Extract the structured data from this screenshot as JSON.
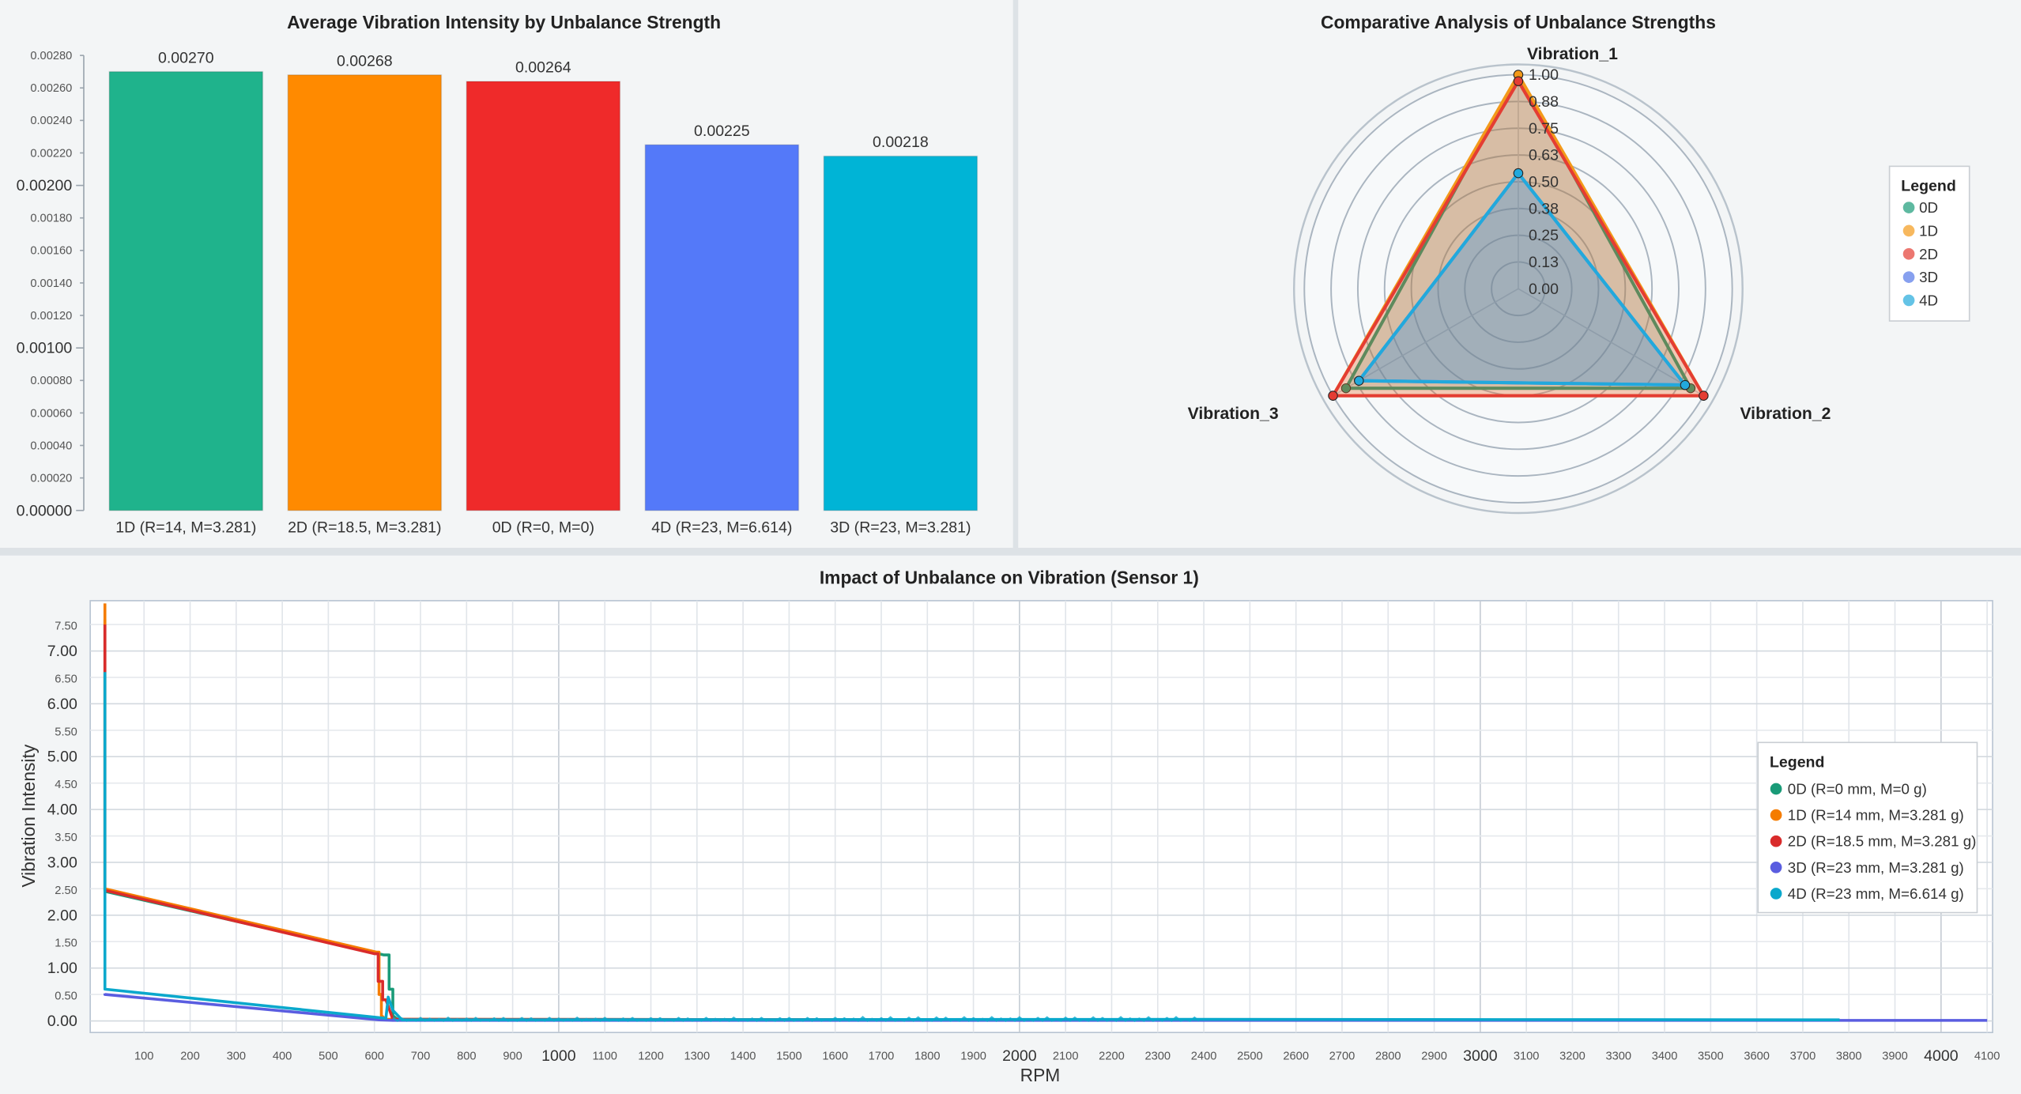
{
  "chart_data": [
    {
      "type": "bar",
      "title": "Average Vibration Intensity by Unbalance Strength",
      "categories": [
        "1D (R=14, M=3.281)",
        "2D (R=18.5, M=3.281)",
        "0D (R=0, M=0)",
        "4D (R=23, M=6.614)",
        "3D (R=23, M=3.281)"
      ],
      "values": [
        0.0027,
        0.00268,
        0.00264,
        0.00225,
        0.00218
      ],
      "value_labels": [
        "0.00270",
        "0.00268",
        "0.00264",
        "0.00225",
        "0.00218"
      ],
      "colors": [
        "#1fb38c",
        "#ff8a00",
        "#ef2a2a",
        "#5479f9",
        "#00b4d6"
      ],
      "ylim": [
        0,
        0.0028
      ],
      "yticks": [
        "0.00000",
        "0.00020",
        "0.00040",
        "0.00060",
        "0.00080",
        "0.00100",
        "0.00120",
        "0.00140",
        "0.00160",
        "0.00180",
        "0.00200",
        "0.00220",
        "0.00240",
        "0.00260",
        "0.00280"
      ],
      "xlabel": "",
      "ylabel": ""
    },
    {
      "type": "radar",
      "title": "Comparative Analysis of Unbalance Strengths",
      "axes": [
        "Vibration_1",
        "Vibration_2",
        "Vibration_3"
      ],
      "rticks": [
        "0.00",
        "0.13",
        "0.25",
        "0.38",
        "0.50",
        "0.63",
        "0.75",
        "0.88",
        "1.00"
      ],
      "rlim": [
        0,
        1
      ],
      "legend_title": "Legend",
      "legend_position": "right",
      "series": [
        {
          "name": "0D",
          "color": "#1a9b78",
          "values": [
            1.0,
            0.93,
            0.93
          ]
        },
        {
          "name": "1D",
          "color": "#f39a1a",
          "values": [
            1.0,
            1.0,
            1.0
          ]
        },
        {
          "name": "2D",
          "color": "#e43d33",
          "values": [
            0.97,
            1.0,
            1.0
          ]
        },
        {
          "name": "3D",
          "color": "#5478e8",
          "values": [
            0.54,
            0.9,
            0.86
          ]
        },
        {
          "name": "4D",
          "color": "#22a9dc",
          "values": [
            0.54,
            0.9,
            0.86
          ]
        }
      ]
    },
    {
      "type": "line",
      "title": "Impact of Unbalance on Vibration (Sensor 1)",
      "xlabel": "RPM",
      "ylabel": "Vibration Intensity",
      "xlim": [
        0,
        4100
      ],
      "ylim": [
        0,
        8.0
      ],
      "xticks": [
        100,
        200,
        300,
        400,
        500,
        600,
        700,
        800,
        900,
        1000,
        1100,
        1200,
        1300,
        1400,
        1500,
        1600,
        1700,
        1800,
        1900,
        2000,
        2100,
        2200,
        2300,
        2400,
        2500,
        2600,
        2700,
        2800,
        2900,
        3000,
        3100,
        3200,
        3300,
        3400,
        3500,
        3600,
        3700,
        3800,
        3900,
        4000,
        4100
      ],
      "yticks": [
        "0.00",
        "0.50",
        "1.00",
        "1.50",
        "2.00",
        "2.50",
        "3.00",
        "3.50",
        "4.00",
        "4.50",
        "5.00",
        "5.50",
        "6.00",
        "6.50",
        "7.00",
        "7.50"
      ],
      "legend_title": "Legend",
      "legend_position": "right",
      "series": [
        {
          "name": "0D (R=0 mm, M=0 g)",
          "color": "#1a9b78",
          "x": [
            15,
            15,
            15,
            620,
            632,
            632,
            640,
            640,
            650,
            2380
          ],
          "y": [
            7.6,
            6.5,
            2.45,
            1.25,
            1.25,
            0.6,
            0.6,
            0.1,
            0.03,
            0.02
          ]
        },
        {
          "name": "1D (R=14 mm, M=3.281 g)",
          "color": "#f57c00",
          "x": [
            15,
            15,
            15,
            605,
            610,
            610,
            615,
            615,
            625,
            2380
          ],
          "y": [
            7.9,
            7.0,
            2.5,
            1.3,
            1.3,
            0.5,
            0.5,
            0.1,
            0.03,
            0.02
          ]
        },
        {
          "name": "2D (R=18.5 mm, M=3.281 g)",
          "color": "#d92b2b",
          "x": [
            15,
            15,
            15,
            600,
            608,
            608,
            618,
            618,
            625,
            640,
            2380
          ],
          "y": [
            7.5,
            6.6,
            2.47,
            1.27,
            1.27,
            0.75,
            0.75,
            0.4,
            0.4,
            0.03,
            0.02
          ]
        },
        {
          "name": "3D (R=23 mm, M=3.281 g)",
          "color": "#5a5de0",
          "x": [
            15,
            15,
            610,
            640,
            3830,
            4100
          ],
          "y": [
            0.52,
            0.5,
            0.02,
            0.01,
            0.01,
            0.01
          ]
        },
        {
          "name": "4D (R=23 mm, M=6.614 g)",
          "color": "#0aa8cc",
          "x": [
            15,
            15,
            15,
            625,
            630,
            630,
            640,
            640,
            660,
            2380,
            3780
          ],
          "y": [
            6.6,
            5.5,
            0.6,
            0.05,
            0.45,
            0.45,
            0.2,
            0.2,
            0.02,
            0.03,
            0.02
          ]
        }
      ]
    }
  ]
}
